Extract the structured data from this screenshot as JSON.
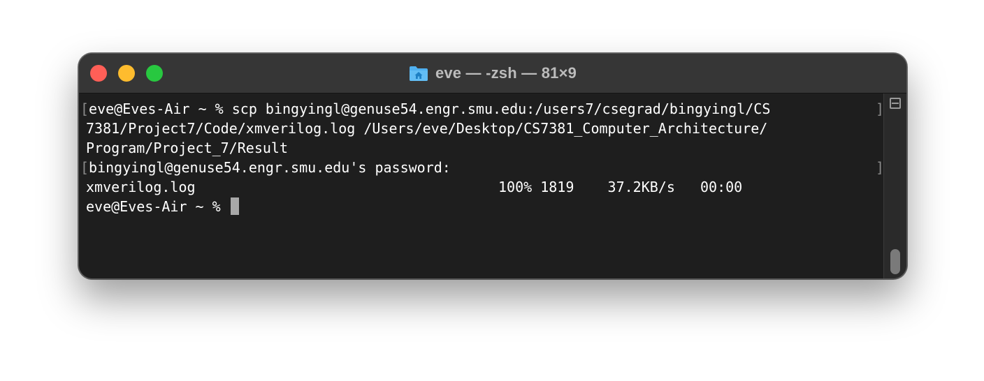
{
  "window": {
    "title": "eve — -zsh — 81×9"
  },
  "terminal": {
    "lines": [
      "eve@Eves-Air ~ % scp bingyingl@genuse54.engr.smu.edu:/users7/csegrad/bingyingl/CS",
      "7381/Project7/Code/xmverilog.log /Users/eve/Desktop/CS7381_Computer_Architecture/",
      "Program/Project_7/Result",
      "bingyingl@genuse54.engr.smu.edu's password:",
      "xmverilog.log                                    100% 1819    37.2KB/s   00:00",
      "eve@Eves-Air ~ % "
    ]
  },
  "icons": {
    "close": "close-traffic-light-icon",
    "minimize": "minimize-traffic-light-icon",
    "maximize": "maximize-traffic-light-icon",
    "folder": "home-folder-icon",
    "split": "split-pane-icon"
  },
  "colors": {
    "close": "#ff5f57",
    "minimize": "#febc2e",
    "maximize": "#28c840",
    "terminal_bg": "#1e1e1e",
    "text": "#ffffff",
    "folder": "#4fb0f0"
  }
}
